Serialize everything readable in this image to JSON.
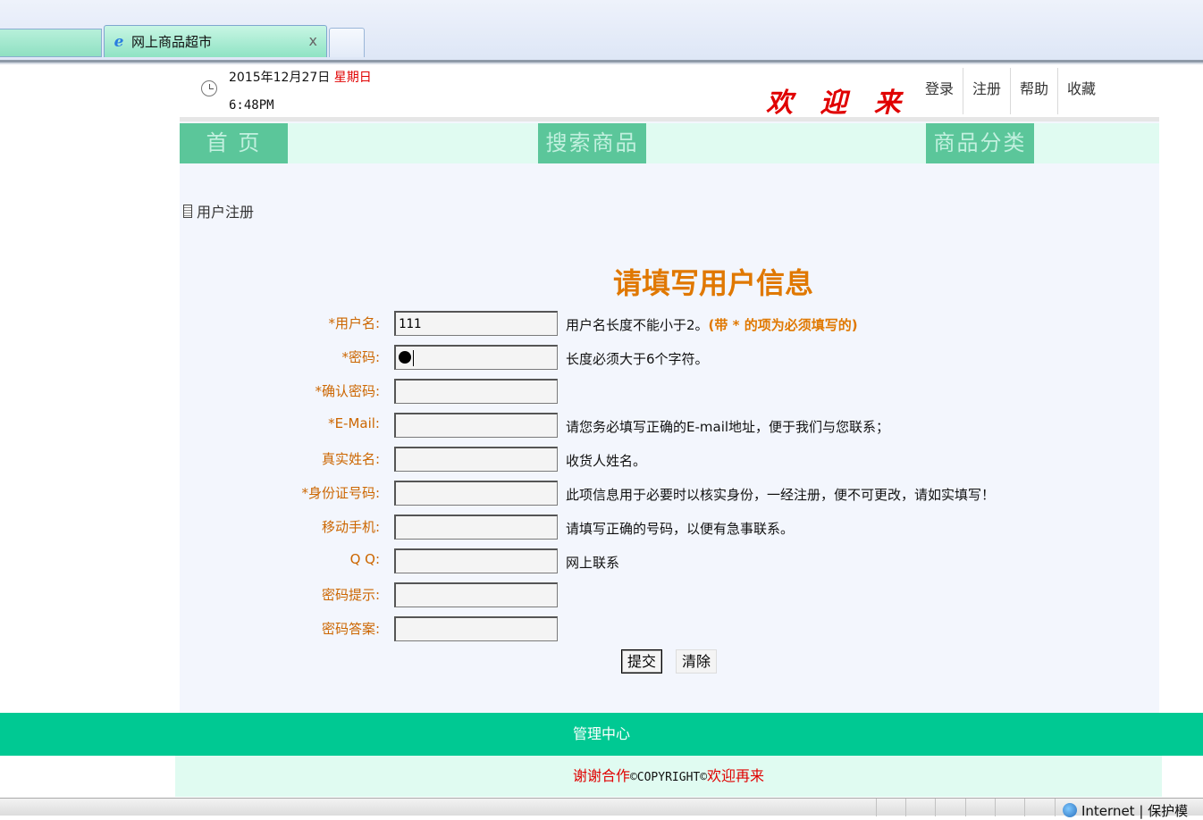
{
  "browser": {
    "tab_title": "网上商品超市",
    "tab_close": "x",
    "status_zone": "Internet | 保护模"
  },
  "header": {
    "date": "2015年12月27日",
    "weekday": "星期日",
    "time": "6:48PM",
    "welcome": "欢 迎 来 到",
    "links": [
      "登录",
      "注册",
      "帮助",
      "收藏"
    ]
  },
  "nav": {
    "items": [
      "首 页",
      "搜索商品",
      "商品分类"
    ]
  },
  "breadcrumb": "用户注册",
  "form": {
    "title": "请填写用户信息",
    "fields": [
      {
        "label": "*用户名:",
        "value": "111",
        "hint": "用户名长度不能小于2。",
        "hint_required": "(带 * 的项为必须填写的)"
      },
      {
        "label": "*密码:",
        "value": "",
        "hint": "长度必须大于6个字符。"
      },
      {
        "label": "*确认密码:",
        "value": "",
        "hint": ""
      },
      {
        "label": "*E-Mail:",
        "value": "",
        "hint": "请您务必填写正确的E-mail地址，便于我们与您联系；"
      },
      {
        "label": "真实姓名:",
        "value": "",
        "hint": "收货人姓名。"
      },
      {
        "label": "*身份证号码:",
        "value": "",
        "hint": "此项信息用于必要时以核实身份，一经注册，便不可更改，请如实填写！"
      },
      {
        "label": "移动手机:",
        "value": "",
        "hint": "请填写正确的号码，以便有急事联系。"
      },
      {
        "label": "Q Q:",
        "value": "",
        "hint": "网上联系"
      },
      {
        "label": "密码提示:",
        "value": "",
        "hint": ""
      },
      {
        "label": "密码答案:",
        "value": "",
        "hint": ""
      }
    ],
    "submit_label": "提交",
    "clear_label": "清除"
  },
  "footer": {
    "admin_link": "管理中心",
    "copy_left": "谢谢合作",
    "copy_mid": "©COPYRIGHT©",
    "copy_right": "欢迎再来"
  },
  "colors": {
    "accent_green": "#00c993",
    "nav_green": "#5bc69a",
    "label_orange": "#cc6600",
    "title_orange": "#e07800",
    "welcome_red": "#e00000"
  }
}
